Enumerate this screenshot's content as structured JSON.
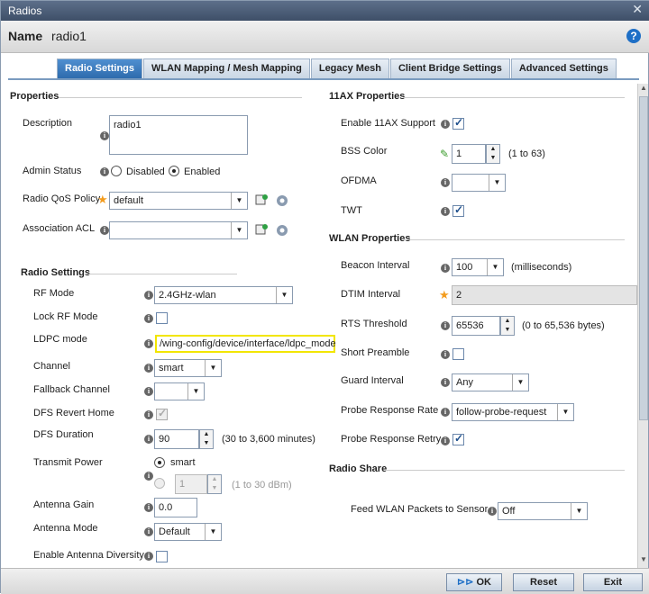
{
  "window": {
    "title": "Radios",
    "name_label": "Name",
    "name_value": "radio1",
    "help": "?",
    "close": "✕"
  },
  "tabs": [
    "Radio Settings",
    "WLAN Mapping / Mesh Mapping",
    "Legacy Mesh",
    "Client Bridge Settings",
    "Advanced Settings"
  ],
  "properties": {
    "section": "Properties",
    "description_label": "Description",
    "description_value": "radio1",
    "admin_status_label": "Admin Status",
    "admin_disabled": "Disabled",
    "admin_enabled": "Enabled",
    "admin_selected": "Enabled",
    "qos_label": "Radio QoS Policy",
    "qos_value": "default",
    "acl_label": "Association ACL",
    "acl_value": ""
  },
  "radio": {
    "section": "Radio Settings",
    "rf_mode_label": "RF Mode",
    "rf_mode_value": "2.4GHz-wlan",
    "lock_rf_label": "Lock RF Mode",
    "lock_rf_checked": false,
    "ldpc_label": "LDPC mode",
    "ldpc_value": "/wing-config/device/interface/ldpc_mode",
    "channel_label": "Channel",
    "channel_value": "smart",
    "fallback_label": "Fallback Channel",
    "fallback_value": "",
    "dfs_revert_label": "DFS Revert Home",
    "dfs_revert_checked": true,
    "dfs_duration_label": "DFS Duration",
    "dfs_duration_value": "90",
    "dfs_duration_hint": "(30 to 3,600 minutes)",
    "tx_power_label": "Transmit Power",
    "tx_smart": "smart",
    "tx_value": "1",
    "tx_hint": "(1 to 30 dBm)",
    "antenna_gain_label": "Antenna Gain",
    "antenna_gain_value": "0.0",
    "antenna_mode_label": "Antenna Mode",
    "antenna_mode_value": "Default",
    "antenna_div_label": "Enable Antenna Diversity",
    "antenna_div_checked": false
  },
  "ax": {
    "section": "11AX Properties",
    "enable_label": "Enable 11AX Support",
    "enable_checked": true,
    "bss_label": "BSS Color",
    "bss_value": "1",
    "bss_hint": "(1 to 63)",
    "ofdma_label": "OFDMA",
    "ofdma_value": "",
    "twt_label": "TWT",
    "twt_checked": true
  },
  "wlan": {
    "section": "WLAN Properties",
    "beacon_label": "Beacon Interval",
    "beacon_value": "100",
    "beacon_hint": "(milliseconds)",
    "dtim_label": "DTIM Interval",
    "dtim_value": "2",
    "rts_label": "RTS Threshold",
    "rts_value": "65536",
    "rts_hint": "(0 to 65,536 bytes)",
    "preamble_label": "Short Preamble",
    "preamble_checked": false,
    "guard_label": "Guard Interval",
    "guard_value": "Any",
    "probe_rate_label": "Probe Response Rate",
    "probe_rate_value": "follow-probe-request",
    "probe_retry_label": "Probe Response Retry",
    "probe_retry_checked": true
  },
  "share": {
    "section": "Radio Share",
    "feed_label": "Feed WLAN Packets to Sensor",
    "feed_value": "Off"
  },
  "footer": {
    "ok": "OK",
    "reset": "Reset",
    "exit": "Exit"
  },
  "colors": {
    "active_tab": "#3a7abf",
    "highlight_border": "#f2e600",
    "required_star": "#f39c1e"
  }
}
